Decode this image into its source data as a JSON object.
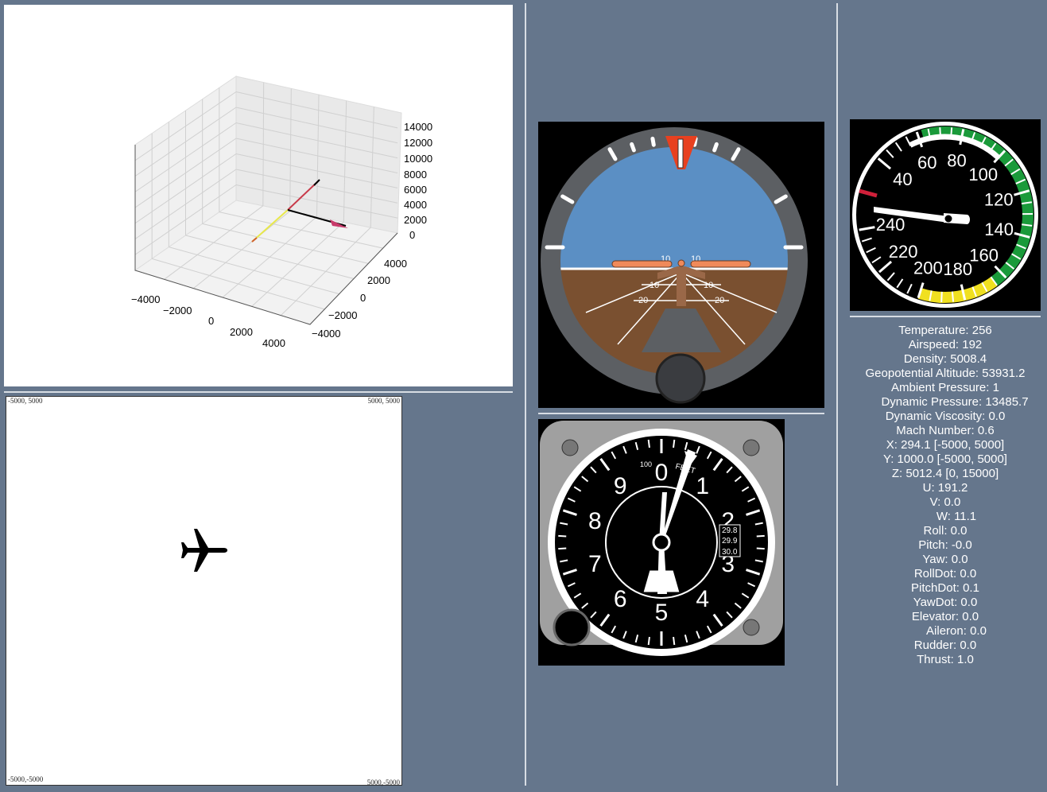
{
  "plot3d": {
    "z_ticks": [
      "14000",
      "12000",
      "10000",
      "8000",
      "6000",
      "4000",
      "2000",
      "0"
    ],
    "x_ticks": [
      "−4000",
      "−2000",
      "0",
      "2000",
      "4000"
    ],
    "y_ticks": [
      "4000",
      "2000",
      "0",
      "−2000",
      "−4000"
    ]
  },
  "map2d": {
    "corner_tl": "-5000, 5000",
    "corner_tr": "5000, 5000",
    "corner_bl": "-5000,-5000",
    "corner_br": "5000,-5000"
  },
  "attitude": {
    "pitch_ticks": [
      "10",
      "10",
      "10",
      "10",
      "20",
      "20"
    ],
    "roll_deg": 0.0,
    "pitch_deg": 0.0
  },
  "altimeter": {
    "numbers": [
      "0",
      "1",
      "2",
      "3",
      "4",
      "5",
      "6",
      "7",
      "8",
      "9"
    ],
    "unit": "FEET",
    "scale": "100",
    "kollsman": [
      "29.8",
      "29.9",
      "30.0"
    ]
  },
  "airspeed_gauge": {
    "numbers": [
      "40",
      "60",
      "80",
      "100",
      "120",
      "140",
      "160",
      "180",
      "200",
      "220",
      "240"
    ],
    "value": 192
  },
  "colors": {
    "sky": "#5b8fc4",
    "ground": "#7a5030",
    "bezel": "#5c5f63",
    "accent": "#e8401f",
    "panel": "#65768c"
  },
  "readouts": [
    "Temperature: 256",
    "Airspeed: 192",
    "Density: 5008.4",
    "Geopotential Altitude: 53931.2",
    "Ambient Pressure: 1",
    "Dynamic Pressure: 13485.7",
    "Dynamic Viscosity: 0.0",
    "Mach Number: 0.6",
    "X: 294.1 [-5000, 5000]",
    "Y: 1000.0 [-5000, 5000]",
    "Z: 5012.4 [0, 15000]",
    "U: 191.2",
    "V: 0.0",
    "W: 11.1",
    "Roll: 0.0",
    "Pitch: -0.0",
    "Yaw: 0.0",
    "RollDot: 0.0",
    "PitchDot: 0.1",
    "YawDot: 0.0",
    "Elevator: 0.0",
    "Aileron: 0.0",
    "Rudder: 0.0",
    "Thrust: 1.0"
  ]
}
